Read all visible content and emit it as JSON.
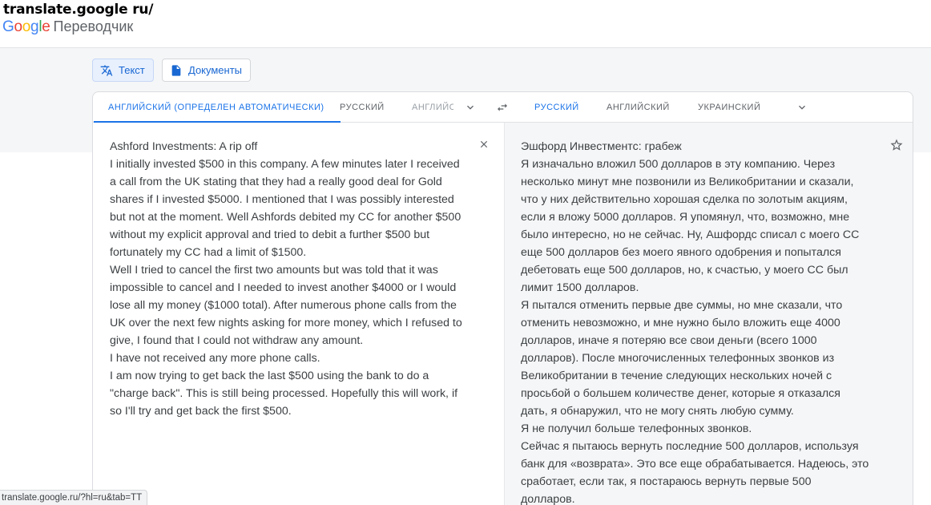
{
  "caption": "translate.google ru/",
  "brand": {
    "logo_letters": [
      "G",
      "o",
      "o",
      "g",
      "l",
      "e"
    ],
    "logo_colors": [
      "#4285f4",
      "#ea4335",
      "#fbbc05",
      "#4285f4",
      "#34a853",
      "#ea4335"
    ],
    "product": "Переводчик"
  },
  "modes": {
    "text_label": "Текст",
    "docs_label": "Документы"
  },
  "source_langs": {
    "detected": "АНГЛИЙСКИЙ (ОПРЕДЕЛЕН АВТОМАТИЧЕСКИ)",
    "lang2": "РУССКИЙ",
    "lang3": "АНГЛИЙС"
  },
  "target_langs": {
    "lang1": "РУССКИЙ",
    "lang2": "АНГЛИЙСКИЙ",
    "lang3": "УКРАИНСКИЙ"
  },
  "source_text": [
    "Ashford Investments: A rip off",
    "I initially invested $500 in this company. A few minutes later I received",
    "a call from the UK stating that they had a really good deal for Gold",
    "shares if I invested $5000. I mentioned that I was possibly interested",
    "but not at the moment. Well Ashfords debited my CC for another $500",
    "without my explicit approval and tried to debit a further $500 but",
    "fortunately my CC had a limit of $1500.",
    "Well I tried to cancel the first two amounts but was told that it was",
    "impossible to cancel and I needed to invest another $4000 or I would",
    "lose all my money ($1000 total). After numerous phone calls from the",
    "UK over the next few nights asking for more money, which I refused to",
    "give, I found that I could not withdraw any amount.",
    "I have not received any more phone calls.",
    "I am now trying to get back the last $500 using the bank to do a",
    "\"charge back\". This is still being processed. Hopefully this will work, if",
    "so I'll try and get back the first $500."
  ],
  "translated_text": [
    "Эшфорд Инвестментс: грабеж",
    "Я изначально вложил 500 долларов в эту компанию. Через",
    "несколько минут мне позвонили из Великобритании и сказали,",
    "что у них действительно хорошая сделка по золотым акциям,",
    "если я вложу 5000 долларов. Я упомянул, что, возможно, мне",
    "было интересно, но не сейчас. Ну, Ашфордс списал с моего CC",
    "еще 500 долларов без моего явного одобрения и попытался",
    "дебетовать еще 500 долларов, но, к счастью, у моего CC был",
    "лимит 1500 долларов.",
    "Я пытался отменить первые две суммы, но мне сказали, что",
    "отменить невозможно, и мне нужно было вложить еще 4000",
    "долларов, иначе я потеряю все свои деньги (всего 1000",
    "долларов). После многочисленных телефонных звонков из",
    "Великобритании в течение следующих нескольких ночей с",
    "просьбой о большем количестве денег, которые я отказался",
    "дать, я обнаружил, что не могу снять любую сумму.",
    "Я не получил больше телефонных звонков.",
    "Сейчас я пытаюсь вернуть последние 500 долларов, используя",
    "банк для «возврата». Это все еще обрабатывается. Надеюсь, это",
    "сработает, если так, я постараюсь вернуть первые 500",
    "долларов."
  ],
  "status_url": "translate.google.ru/?hl=ru&tab=TT",
  "colors": {
    "accent": "#1a73e8",
    "accent_bg": "#e8f0fe",
    "muted": "#5f6368"
  },
  "icons": [
    "translate-icon",
    "document-icon",
    "chevron-down-icon",
    "swap-icon",
    "close-icon",
    "star-icon"
  ]
}
